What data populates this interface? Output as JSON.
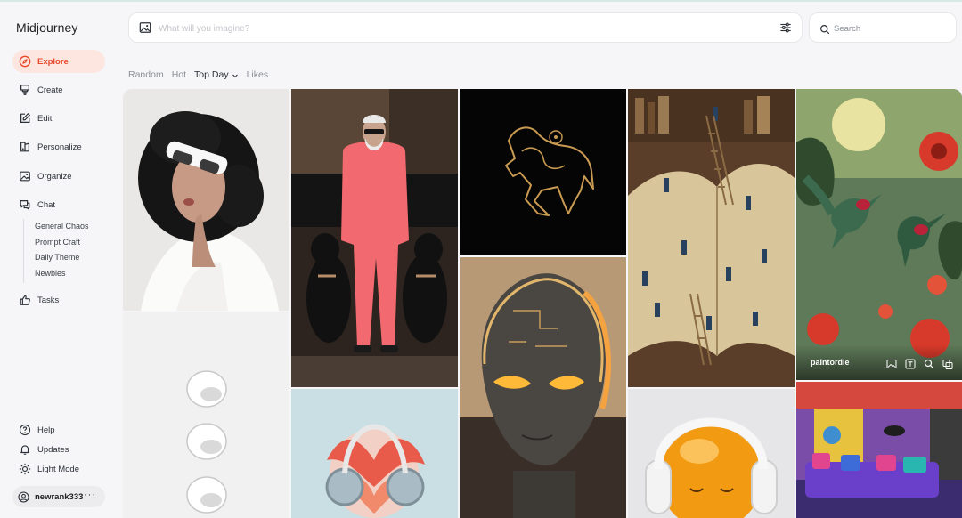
{
  "app": {
    "title": "Midjourney"
  },
  "sidebar": {
    "items": [
      {
        "label": "Explore",
        "icon": "compass-icon",
        "active": true
      },
      {
        "label": "Create",
        "icon": "brush-icon"
      },
      {
        "label": "Edit",
        "icon": "edit-icon"
      },
      {
        "label": "Personalize",
        "icon": "personalize-icon"
      },
      {
        "label": "Organize",
        "icon": "image-icon"
      },
      {
        "label": "Chat",
        "icon": "chat-icon"
      }
    ],
    "chat_rooms": [
      "General Chaos",
      "Prompt Craft",
      "Daily Theme",
      "Newbies"
    ],
    "tasks": {
      "label": "Tasks",
      "icon": "thumbs-up-icon"
    },
    "bottom": [
      {
        "label": "Help",
        "icon": "help-icon"
      },
      {
        "label": "Updates",
        "icon": "bell-icon"
      },
      {
        "label": "Light Mode",
        "icon": "sun-icon"
      }
    ],
    "user": {
      "name": "newrank333",
      "more": "···"
    }
  },
  "imagine": {
    "placeholder": "What will you imagine?",
    "value": ""
  },
  "search": {
    "placeholder": "Search"
  },
  "tabs": [
    {
      "label": "Random"
    },
    {
      "label": "Hot"
    },
    {
      "label": "Top Day",
      "active": true,
      "dropdown": true
    },
    {
      "label": "Likes"
    }
  ],
  "gallery": {
    "hovered_author": "paintordie",
    "hover_actions": [
      "image-icon",
      "text-icon",
      "search-icon",
      "more-icon"
    ]
  },
  "colors": {
    "accent": "#e8492b",
    "active_bg": "#fde6e0"
  }
}
